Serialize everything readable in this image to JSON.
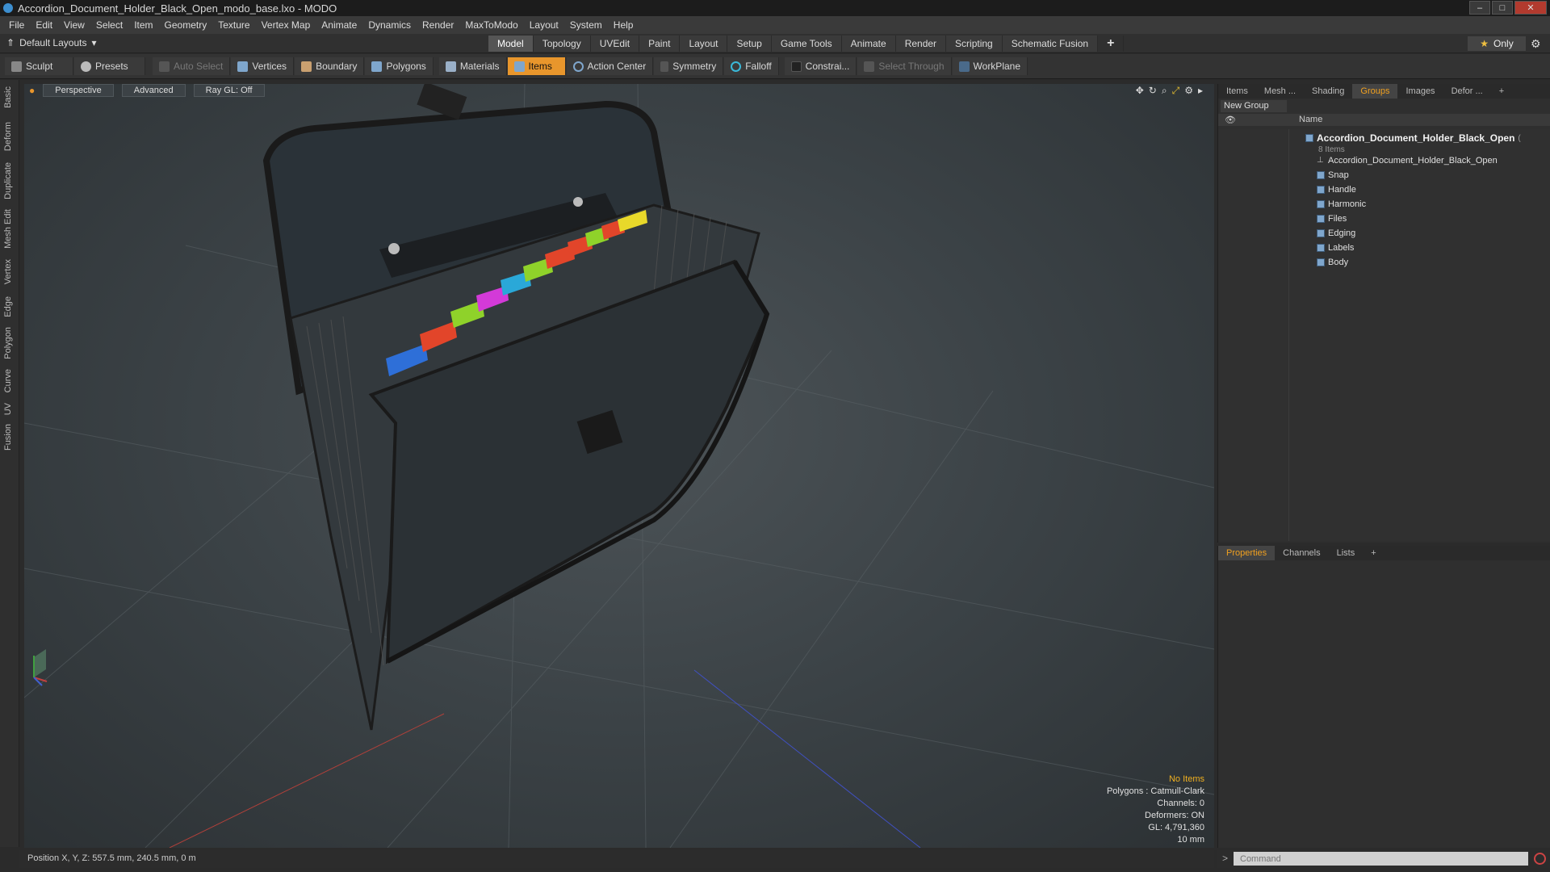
{
  "window": {
    "title": "Accordion_Document_Holder_Black_Open_modo_base.lxo - MODO",
    "controls": [
      "–",
      "□",
      "✕"
    ]
  },
  "menu": [
    "File",
    "Edit",
    "View",
    "Select",
    "Item",
    "Geometry",
    "Texture",
    "Vertex Map",
    "Animate",
    "Dynamics",
    "Render",
    "MaxToModo",
    "Layout",
    "System",
    "Help"
  ],
  "layouts": {
    "dropdown": "Default Layouts",
    "tabs": [
      "Model",
      "Topology",
      "UVEdit",
      "Paint",
      "Layout",
      "Setup",
      "Game Tools",
      "Animate",
      "Render",
      "Scripting",
      "Schematic Fusion"
    ],
    "active_tab": "Model",
    "only_label": "Only"
  },
  "toolbar": {
    "sculpt": "Sculpt",
    "presets": "Presets",
    "auto_select": "Auto Select",
    "vertices": "Vertices",
    "boundary": "Boundary",
    "polygons": "Polygons",
    "materials": "Materials",
    "items": "Items",
    "action_center": "Action Center",
    "symmetry": "Symmetry",
    "falloff": "Falloff",
    "constraints": "Constrai...",
    "select_through": "Select Through",
    "workplane": "WorkPlane"
  },
  "left_tabs": [
    "Basic",
    "Deform",
    "Duplicate",
    "Mesh Edit",
    "Vertex",
    "Edge",
    "Polygon",
    "Curve",
    "UV",
    "Fusion"
  ],
  "viewport": {
    "view": "Perspective",
    "shading": "Advanced",
    "raygl": "Ray GL: Off",
    "info": {
      "selection": "No Items",
      "polygons": "Polygons : Catmull-Clark",
      "channels": "Channels: 0",
      "deformers": "Deformers: ON",
      "gl": "GL: 4,791,360",
      "grid": "10 mm"
    }
  },
  "status": {
    "position": "Position X, Y, Z:  557.5 mm, 240.5 mm, 0 m"
  },
  "right_panel": {
    "tabs": [
      "Items",
      "Mesh ...",
      "Shading",
      "Groups",
      "Images",
      "Defor ..."
    ],
    "active_tab": "Groups",
    "new_group": "New Group",
    "column_name": "Name",
    "root": "Accordion_Document_Holder_Black_Open",
    "root_suffix": "(",
    "root_count": "8 Items",
    "children": [
      "Accordion_Document_Holder_Black_Open",
      "Snap",
      "Handle",
      "Harmonic",
      "Files",
      "Edging",
      "Labels",
      "Body"
    ]
  },
  "bottom_panel": {
    "tabs": [
      "Properties",
      "Channels",
      "Lists"
    ],
    "active_tab": "Properties"
  },
  "command": {
    "placeholder": "Command"
  },
  "colors": {
    "accent": "#e8962c",
    "active_tab_text": "#f0a020",
    "tab_blue": "#2e6fd8",
    "tab_red": "#e2452a",
    "tab_green": "#8fd22a",
    "tab_magenta": "#d33ad8",
    "tab_cyan": "#2aa8d8",
    "tab_yellow": "#e8d82a"
  }
}
